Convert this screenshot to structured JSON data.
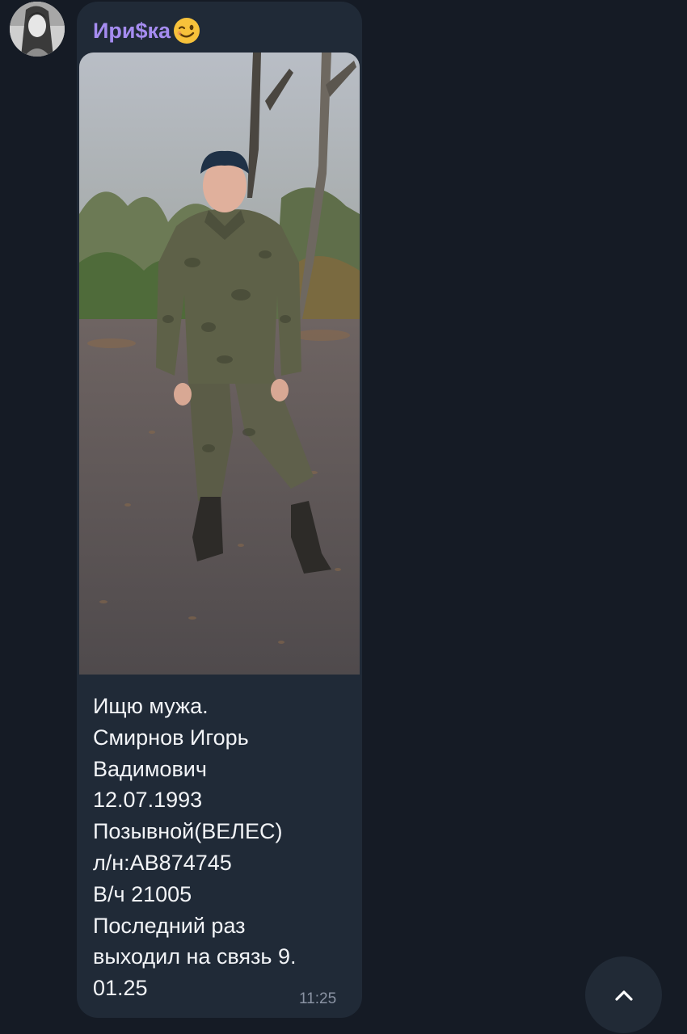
{
  "message": {
    "sender_name": "Ири$ка",
    "sender_emoji_icon": "winking-face-icon",
    "caption_lines": [
      "Ищю мужа.",
      "Смирнов Игорь",
      "Вадимович",
      "12.07.1993",
      "Позывной(ВЕЛЕС)",
      "л/н:АВ874745",
      "В/ч 21005",
      "Последний раз",
      "выходил на связь 9.",
      "01.25"
    ],
    "time": "11:25"
  },
  "controls": {
    "scroll_down_icon": "chevron-up-icon"
  },
  "colors": {
    "background": "#151b25",
    "bubble": "#202a37",
    "sender_name": "#a58cf0",
    "caption_text": "#f2f4f7",
    "time": "#8a93a3"
  }
}
